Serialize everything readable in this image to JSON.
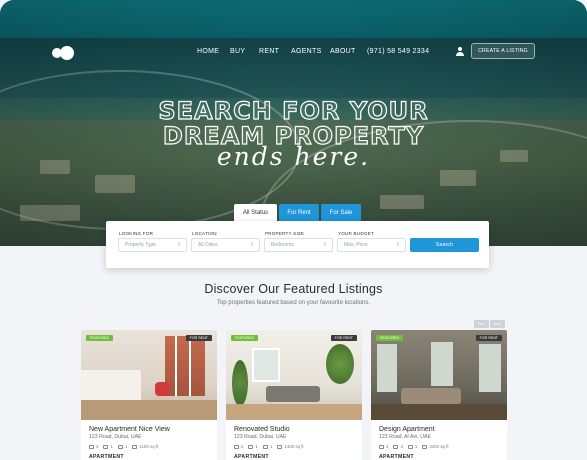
{
  "nav": {
    "links": [
      "HOME",
      "BUY",
      "RENT",
      "AGENTS",
      "ABOUT"
    ],
    "phone": "(971) 58 549 2334",
    "cta": "CREATE A LISTING"
  },
  "hero": {
    "line1": "SEARCH FOR YOUR",
    "line2": "DREAM PROPERTY",
    "script": "ends here."
  },
  "search": {
    "tabs": [
      "All Status",
      "For Rent",
      "For Sale"
    ],
    "fields": [
      {
        "label": "LOOKING FOR",
        "value": "Property Type"
      },
      {
        "label": "LOCATION",
        "value": "All Cities"
      },
      {
        "label": "PROPERTY SIZE",
        "value": "Bedrooms"
      },
      {
        "label": "YOUR BUDGET",
        "value": "Max. Price"
      }
    ],
    "button": "Search"
  },
  "featured": {
    "title": "Discover Our Featured Listings",
    "subtitle": "Top properties featured based on your favourite locations.",
    "pager": [
      "Prev",
      "Next"
    ],
    "cards": [
      {
        "badge": "FEATURED",
        "status": "FOR RENT",
        "title": "New Apartment Nice View",
        "address": "123 Road, Dubai, UAE",
        "beds": "2",
        "baths": "1",
        "parking": "1",
        "area": "1100 sq ft",
        "type": "APARTMENT"
      },
      {
        "badge": "FEATURED",
        "status": "FOR RENT",
        "title": "Renovated Studio",
        "address": "123 Road, Dubai, UAE",
        "beds": "2",
        "baths": "1",
        "parking": "1",
        "area": "1400 sq ft",
        "type": "APARTMENT"
      },
      {
        "badge": "FEATURED",
        "status": "FOR RENT",
        "title": "Design Apartment",
        "address": "123 Road, Al Ain, UAE",
        "beds": "4",
        "baths": "3",
        "parking": "1",
        "area": "2400 sq ft",
        "type": "APARTMENT"
      }
    ]
  },
  "colors": {
    "accent": "#1e96d8",
    "featured": "#6fbf3a",
    "hero": "#0f6f78"
  }
}
